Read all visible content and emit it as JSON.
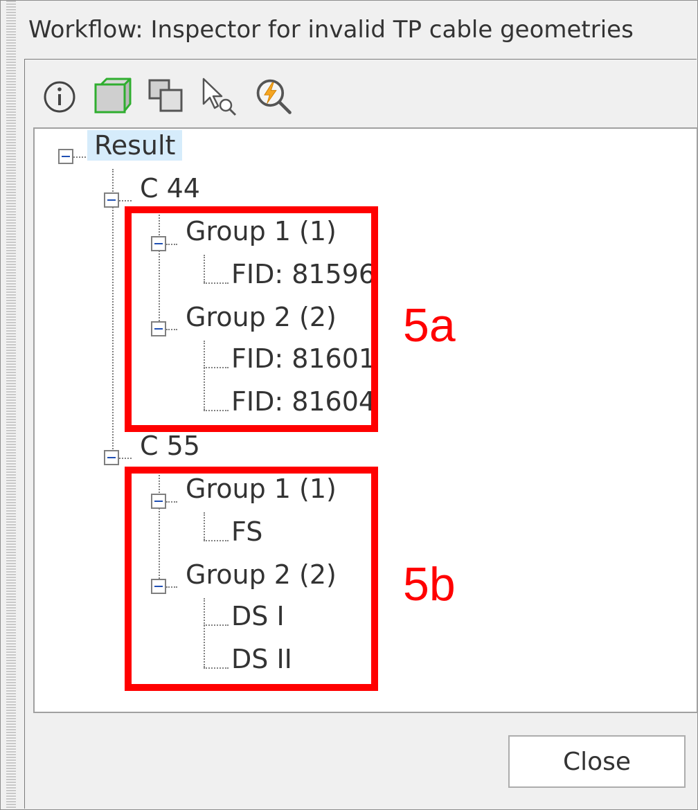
{
  "window": {
    "title": "Workflow: Inspector for invalid TP cable geometries"
  },
  "toolbar": {
    "icons": [
      "info-icon",
      "cube-3d-icon",
      "copy-layers-icon",
      "select-zoom-icon",
      "zoom-flash-icon"
    ]
  },
  "tree": {
    "root": "Result",
    "c44": {
      "label": "C 44",
      "group1": {
        "label": "Group 1 (1)",
        "items": [
          "FID: 81596"
        ]
      },
      "group2": {
        "label": "Group 2 (2)",
        "items": [
          "FID: 81601",
          "FID: 81604"
        ]
      }
    },
    "c55": {
      "label": "C 55",
      "group1": {
        "label": "Group 1 (1)",
        "items": [
          "FS"
        ]
      },
      "group2": {
        "label": "Group 2 (2)",
        "items": [
          "DS I",
          "DS II"
        ]
      }
    }
  },
  "annotations": {
    "a": "5a",
    "b": "5b",
    "color": "#ff0000"
  },
  "buttons": {
    "close": "Close"
  }
}
